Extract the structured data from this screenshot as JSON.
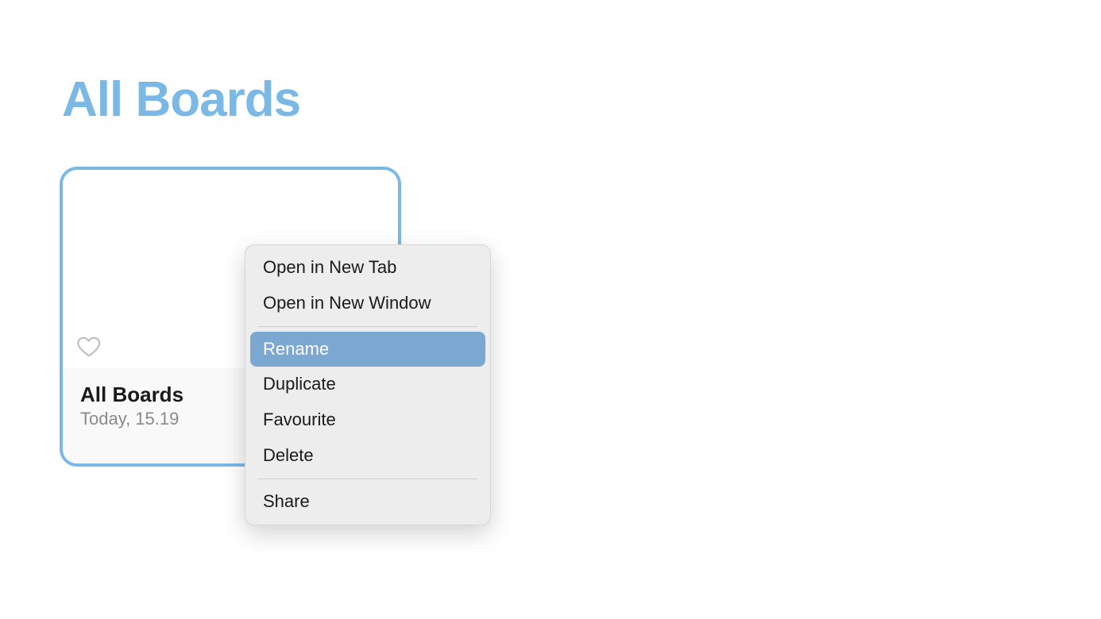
{
  "page": {
    "title": "All Boards"
  },
  "card": {
    "title": "All Boards",
    "timestamp": "Today, 15.19"
  },
  "contextMenu": {
    "group1": [
      {
        "label": "Open in New Tab"
      },
      {
        "label": "Open in New Window"
      }
    ],
    "group2": [
      {
        "label": "Rename",
        "highlighted": true
      },
      {
        "label": "Duplicate"
      },
      {
        "label": "Favourite"
      },
      {
        "label": "Delete"
      }
    ],
    "group3": [
      {
        "label": "Share"
      }
    ]
  }
}
